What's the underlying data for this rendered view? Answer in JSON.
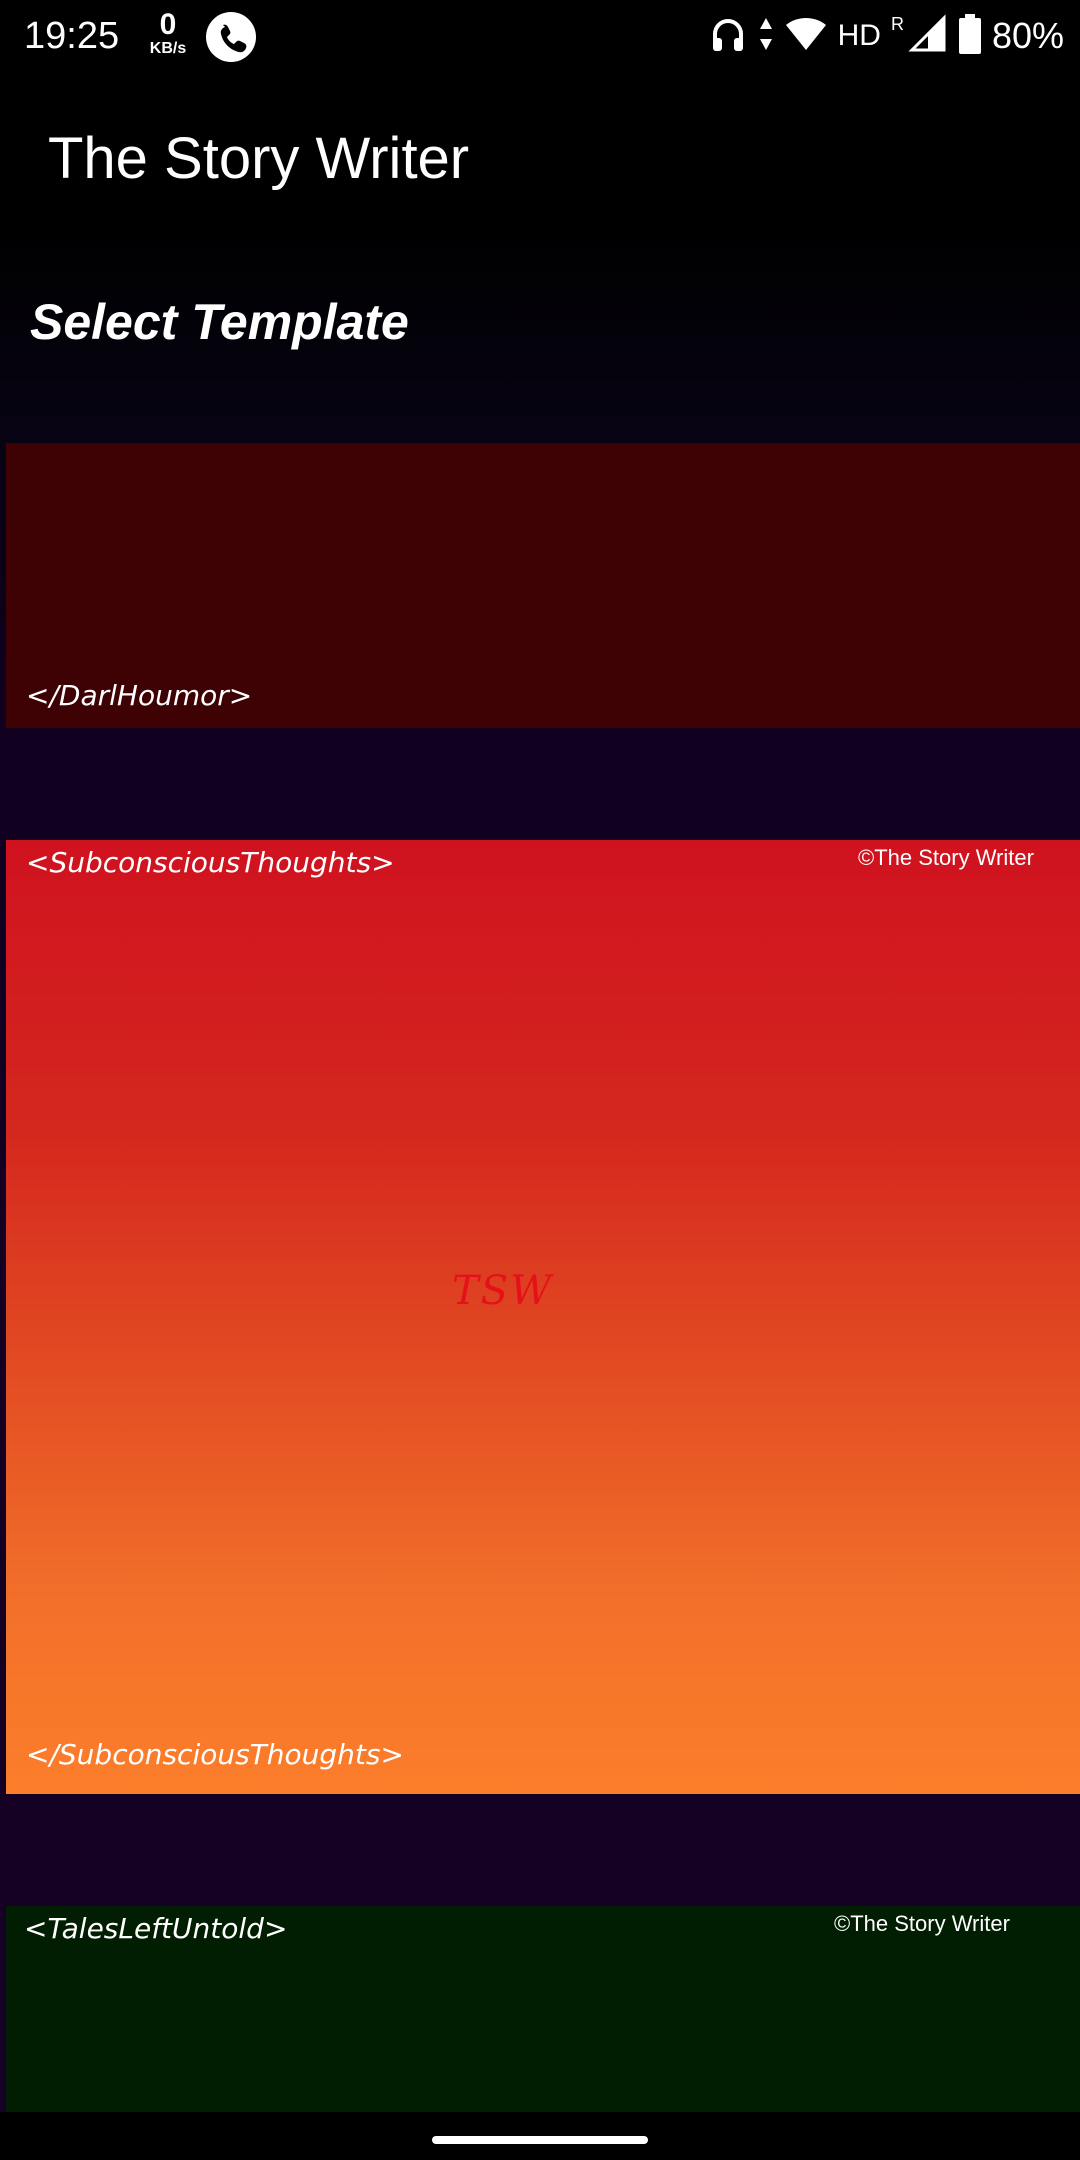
{
  "status_bar": {
    "time": "19:25",
    "net_speed_value": "0",
    "net_speed_unit": "KB/s",
    "icons": [
      "phone-call-icon",
      "headphones-icon",
      "data-arrows-icon",
      "wifi-icon",
      "signal-icon",
      "battery-icon"
    ],
    "hd_label": "HD",
    "roaming_label": "R",
    "battery_percent": "80%"
  },
  "app_bar": {
    "title": "The Story Writer"
  },
  "section": {
    "title": "Select Template"
  },
  "templates": [
    {
      "open_tag": "",
      "close_tag": "</DarlHoumor>",
      "copyright": "",
      "color": "#3e0104"
    },
    {
      "open_tag": "<SubconsciousThoughts>",
      "close_tag": "</SubconsciousThoughts>",
      "copyright": "©The Story Writer",
      "watermark": "TSW",
      "colors": [
        "#d0121f",
        "#fc7e2b"
      ]
    },
    {
      "open_tag": "<TalesLeftUntold>",
      "close_tag": "",
      "copyright": "©The Story Writer",
      "color": "#011e02"
    }
  ]
}
